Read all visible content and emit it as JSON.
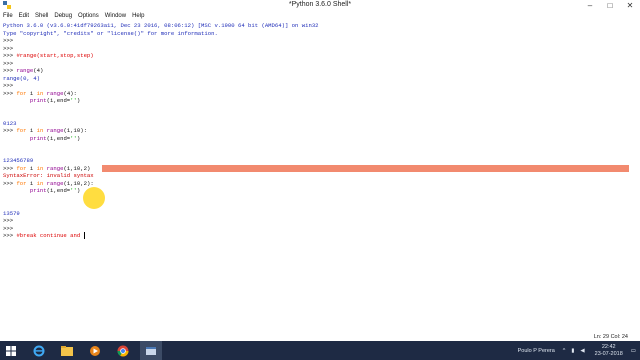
{
  "window": {
    "title": "*Python 3.6.0 Shell*"
  },
  "menu": [
    "File",
    "Edit",
    "Shell",
    "Debug",
    "Options",
    "Window",
    "Help"
  ],
  "shell_lines": [
    {
      "type": "out",
      "text": "Python 3.6.0 (v3.6.0:41df79263a11, Dec 23 2016, 08:06:12) [MSC v.1900 64 bit (AMD64)] on win32"
    },
    {
      "type": "out",
      "text": "Type \"copyright\", \"credits\" or \"license()\" for more information."
    },
    {
      "type": "prompt",
      "text": ">>> "
    },
    {
      "type": "prompt",
      "text": ">>> "
    },
    {
      "type": "code",
      "prompt": ">>> ",
      "text": "#range(start,stop,step)",
      "cls": "c-comment"
    },
    {
      "type": "prompt",
      "text": ">>> "
    },
    {
      "type": "code",
      "prompt": ">>> ",
      "text": "range(4)",
      "cls": "c-builtin"
    },
    {
      "type": "out",
      "text": "range(0, 4)"
    },
    {
      "type": "prompt",
      "text": ">>> "
    },
    {
      "type": "code",
      "prompt": ">>> ",
      "text": "for i in range(4):",
      "cls": ""
    },
    {
      "type": "code",
      "prompt": "        ",
      "text": "print(i,end='')",
      "cls": ""
    },
    {
      "type": "blank",
      "text": ""
    },
    {
      "type": "blank",
      "text": ""
    },
    {
      "type": "out",
      "text": "0123"
    },
    {
      "type": "code",
      "prompt": ">>> ",
      "text": "for i in range(1,10):",
      "cls": ""
    },
    {
      "type": "code",
      "prompt": "        ",
      "text": "print(i,end='')",
      "cls": ""
    },
    {
      "type": "blank",
      "text": ""
    },
    {
      "type": "blank",
      "text": ""
    },
    {
      "type": "out",
      "text": "123456789"
    },
    {
      "type": "error_code",
      "prompt": ">>> ",
      "text": "for i in range(1,10,2)"
    },
    {
      "type": "err",
      "text": "SyntaxError: invalid syntax"
    },
    {
      "type": "code",
      "prompt": ">>> ",
      "text": "for i in range(1,10,2):",
      "cls": ""
    },
    {
      "type": "code",
      "prompt": "        ",
      "text": "print(i,end='')",
      "cls": ""
    },
    {
      "type": "blank",
      "text": ""
    },
    {
      "type": "blank",
      "text": ""
    },
    {
      "type": "out",
      "text": "13579"
    },
    {
      "type": "prompt",
      "text": ">>> "
    },
    {
      "type": "prompt",
      "text": ">>> "
    },
    {
      "type": "current",
      "prompt": ">>> ",
      "text": "#break continue and "
    }
  ],
  "status": {
    "position": "Ln: 29   Col: 24"
  },
  "taskbar": {
    "user": "Poulo P Perera",
    "time": "22:42",
    "date": "23-07-2018",
    "icons": [
      "windows-start-icon",
      "ie-icon",
      "file-explorer-icon",
      "media-player-icon",
      "chrome-icon",
      "python-idle-icon"
    ]
  }
}
